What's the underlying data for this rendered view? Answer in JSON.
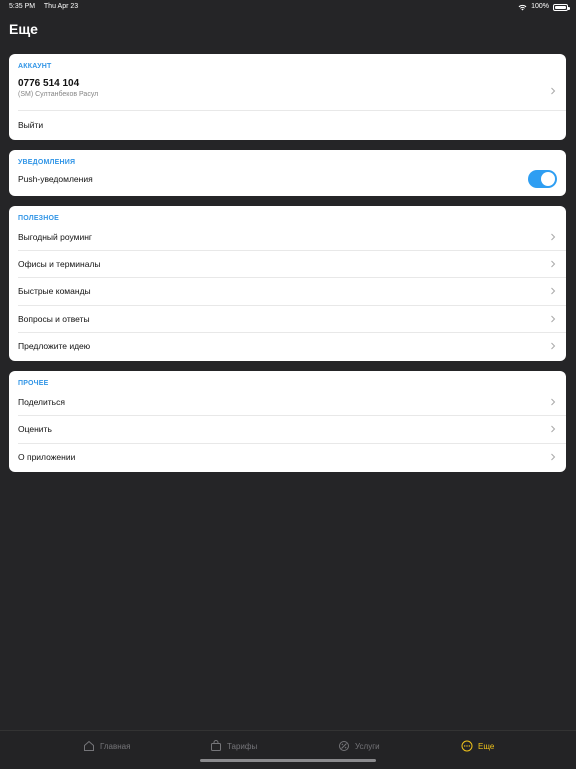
{
  "status": {
    "time": "5:35 PM",
    "date": "Thu Apr 23",
    "battery": "100%"
  },
  "page_title": "Еще",
  "account": {
    "section_title": "АККАУНТ",
    "phone": "0776 514 104",
    "name": "(SM) Султанбеков Расул",
    "logout_label": "Выйти"
  },
  "notifications": {
    "section_title": "УВЕДОМЛЕНИЯ",
    "push_label": "Push-уведомления",
    "push_enabled": true
  },
  "useful": {
    "section_title": "ПОЛЕЗНОЕ",
    "items": [
      {
        "label": "Выгодный роуминг"
      },
      {
        "label": "Офисы и терминалы"
      },
      {
        "label": "Быстрые команды"
      },
      {
        "label": "Вопросы и ответы"
      },
      {
        "label": "Предложите идею"
      }
    ]
  },
  "other": {
    "section_title": "ПРОЧЕЕ",
    "items": [
      {
        "label": "Поделиться"
      },
      {
        "label": "Оценить"
      },
      {
        "label": "О приложении"
      }
    ]
  },
  "tabs": [
    {
      "label": "Главная",
      "icon": "home-icon",
      "active": false
    },
    {
      "label": "Тарифы",
      "icon": "bag-icon",
      "active": false
    },
    {
      "label": "Услуги",
      "icon": "services-icon",
      "active": false
    },
    {
      "label": "Еще",
      "icon": "more-icon",
      "active": true
    }
  ],
  "colors": {
    "background": "#252527",
    "accent_blue": "#2e9ef2",
    "active_tab": "#f0c31b"
  }
}
